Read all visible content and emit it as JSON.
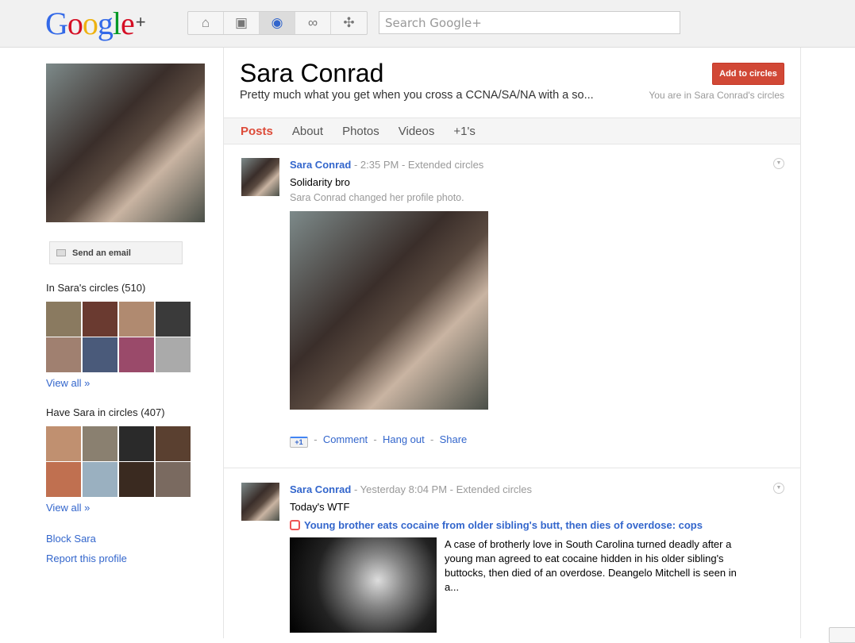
{
  "header": {
    "logo": "Google+",
    "search_placeholder": "Search Google+",
    "nav": [
      {
        "name": "home-icon",
        "glyph": "⌂"
      },
      {
        "name": "photos-icon",
        "glyph": "▣"
      },
      {
        "name": "profile-icon",
        "glyph": "◉"
      },
      {
        "name": "circles-icon",
        "glyph": "∞"
      },
      {
        "name": "games-icon",
        "glyph": "✣"
      }
    ]
  },
  "sidebar": {
    "send_email": "Send an email",
    "in_circles": "In Sara's circles (510)",
    "have_in_circles": "Have Sara in circles (407)",
    "view_all": "View all »",
    "block": "Block Sara",
    "report": "Report this profile"
  },
  "profile": {
    "name": "Sara Conrad",
    "tagline": "Pretty much what you get when you cross a CCNA/SA/NA with a so...",
    "add_button": "Add to circles",
    "in_circles_note": "You are in Sara Conrad's circles"
  },
  "tabs": [
    "Posts",
    "About",
    "Photos",
    "Videos",
    "+1's"
  ],
  "posts": [
    {
      "author": "Sara Conrad",
      "time": "2:35 PM",
      "visibility": "Extended circles",
      "text": "Solidarity bro",
      "subtext": "Sara Conrad changed her profile photo.",
      "plus_one": "+1",
      "actions": [
        "Comment",
        "Hang out",
        "Share"
      ]
    },
    {
      "author": "Sara Conrad",
      "time": "Yesterday 8:04 PM",
      "visibility": "Extended circles",
      "text": "Today's WTF",
      "link_title": "Young brother eats cocaine from older sibling's butt, then dies of overdose: cops",
      "link_snippet": "A case of brotherly love in South Carolina turned deadly after a young man agreed to eat cocaine hidden in his older sibling's buttocks, then died of an overdose. Deangelo Mitchell is seen in a..."
    }
  ],
  "separator": "-"
}
